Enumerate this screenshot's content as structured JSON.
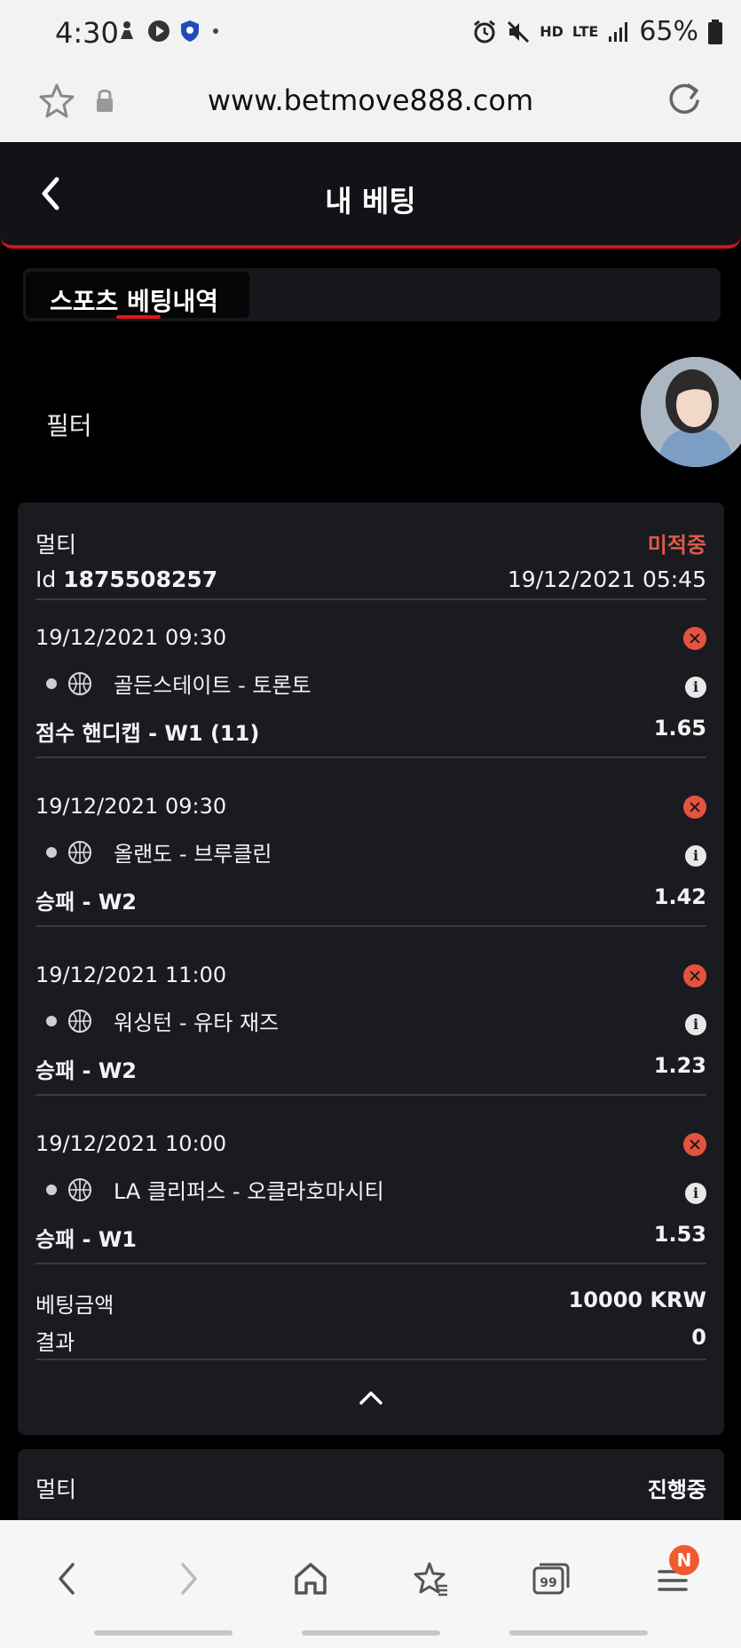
{
  "status_bar": {
    "time": "4:30",
    "network": "LTE",
    "voice": "HD",
    "battery": "65%"
  },
  "browser": {
    "url": "www.betmove888.com"
  },
  "header": {
    "title": "내 베팅"
  },
  "tabs": [
    {
      "label": "스포츠 베팅내역",
      "active": true
    }
  ],
  "filter": {
    "label": "필터"
  },
  "bets": [
    {
      "type": "멀티",
      "status": "미적중",
      "id_label": "Id",
      "id": "1875508257",
      "placed_at": "19/12/2021 05:45",
      "selections": [
        {
          "datetime": "19/12/2021 09:30",
          "match": "골든스테이트 - 토론토",
          "market": "점수 핸디캡 - W1 (11)",
          "odds": "1.65"
        },
        {
          "datetime": "19/12/2021 09:30",
          "match": "올랜도 - 브루클린",
          "market": "승패 - W2",
          "odds": "1.42"
        },
        {
          "datetime": "19/12/2021 11:00",
          "match": "워싱턴 - 유타 재즈",
          "market": "승패 - W2",
          "odds": "1.23"
        },
        {
          "datetime": "19/12/2021 10:00",
          "match": "LA 클리퍼스 - 오클라호마시티",
          "market": "승패 - W1",
          "odds": "1.53"
        }
      ],
      "amount_label": "베팅금액",
      "amount": "10000 KRW",
      "result_label": "결과",
      "result": "0"
    },
    {
      "type": "멀티",
      "status": "진행중"
    }
  ],
  "colors": {
    "accent": "#d3151b",
    "lost": "#e05a45",
    "card_bg": "#1a1b20",
    "page_bg": "#000000"
  },
  "bottom_nav": {
    "tabs_count": "99",
    "menu_badge": "N"
  }
}
